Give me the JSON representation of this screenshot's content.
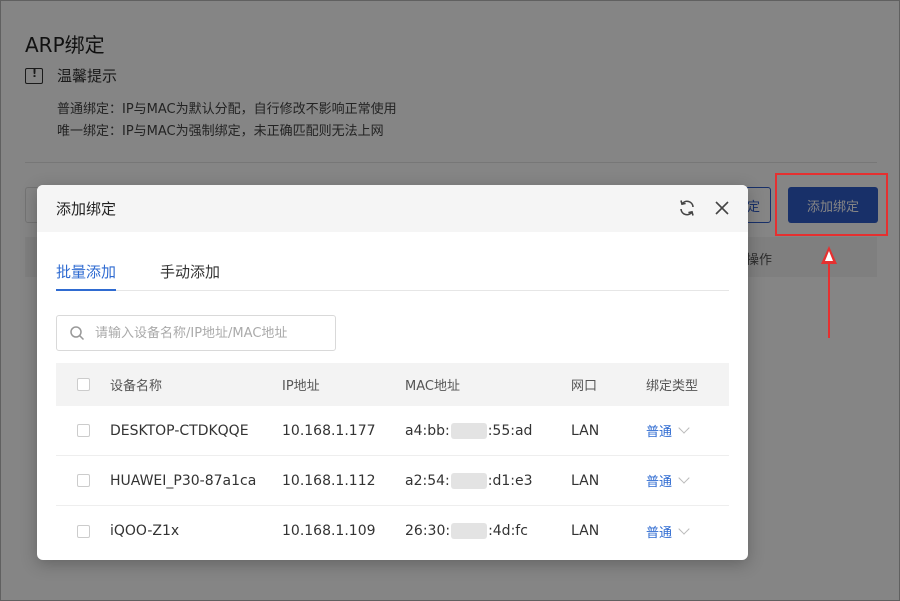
{
  "page": {
    "title": "ARP绑定",
    "tip_title": "温馨提示",
    "tip_line1": "普通绑定：IP与MAC为默认分配，自行修改不影响正常使用",
    "tip_line2": "唯一绑定：IP与MAC为强制绑定，未正确匹配则无法上网",
    "add_button": "添加绑定",
    "partial_button": "定",
    "table_op_header": "操作"
  },
  "modal": {
    "title": "添加绑定",
    "tabs": [
      {
        "label": "批量添加",
        "active": true
      },
      {
        "label": "手动添加",
        "active": false
      }
    ],
    "search_placeholder": "请输入设备名称/IP地址/MAC地址",
    "columns": [
      "设备名称",
      "IP地址",
      "MAC地址",
      "网口",
      "绑定类型"
    ],
    "rows": [
      {
        "name": "DESKTOP-CTDKQQE",
        "ip": "10.168.1.177",
        "mac_prefix": "a4:bb:",
        "mac_suffix": ":55:ad",
        "port": "LAN",
        "type": "普通"
      },
      {
        "name": "HUAWEI_P30-87a1ca",
        "ip": "10.168.1.112",
        "mac_prefix": "a2:54:",
        "mac_suffix": ":d1:e3",
        "port": "LAN",
        "type": "普通"
      },
      {
        "name": "iQOO-Z1x",
        "ip": "10.168.1.109",
        "mac_prefix": "26:30:",
        "mac_suffix": ":4d:fc",
        "port": "LAN",
        "type": "普通"
      }
    ]
  },
  "colors": {
    "accent": "#2f6bd1",
    "primary_button": "#2f5cc9",
    "annotation_red": "#e53030"
  },
  "icons": [
    "info-icon",
    "refresh-icon",
    "close-icon",
    "search-icon",
    "chevron-down-icon"
  ]
}
